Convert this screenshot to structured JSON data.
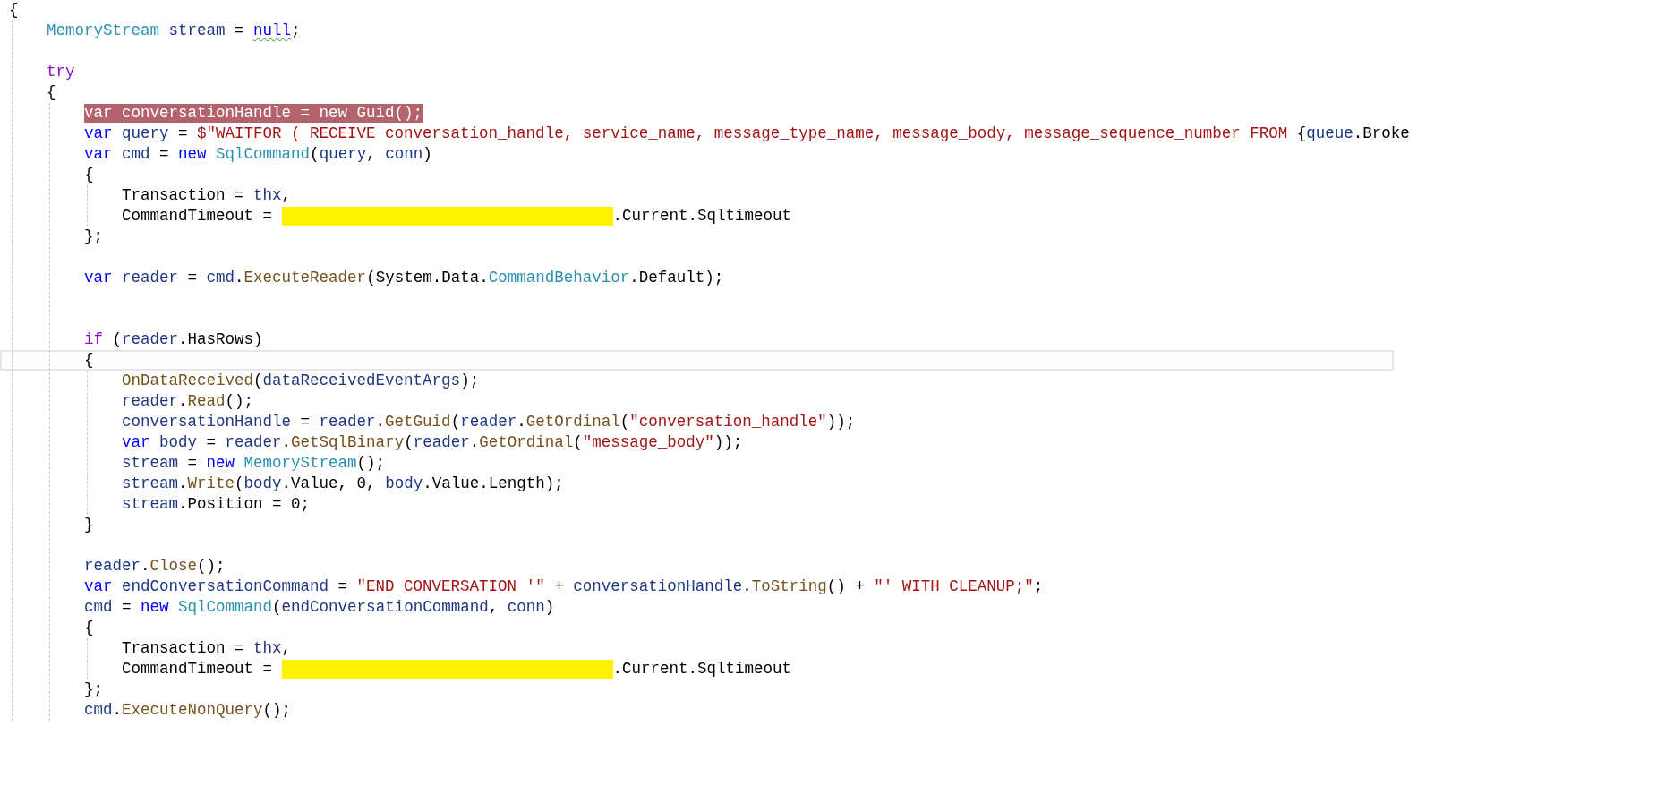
{
  "editor": {
    "lines": [
      {
        "kind": "code",
        "current": false,
        "segments": [
          {
            "kind": "code",
            "highlighted": false,
            "tokens": [
              {
                "text": "{",
                "kind": "plain"
              }
            ]
          }
        ]
      },
      {
        "kind": "code",
        "current": false,
        "segments": [
          {
            "kind": "code",
            "highlighted": false,
            "tokens": [
              {
                "text": "    MemoryStream",
                "kind": "type"
              },
              {
                "text": " stream",
                "kind": "ident"
              },
              {
                "text": " = ",
                "kind": "plain"
              },
              {
                "text": "null",
                "kind": "keyword",
                "warning": true
              },
              {
                "text": ";",
                "kind": "plain"
              }
            ]
          }
        ]
      },
      {
        "kind": "blank",
        "current": false
      },
      {
        "kind": "code",
        "current": false,
        "segments": [
          {
            "kind": "code",
            "highlighted": false,
            "tokens": [
              {
                "text": "    try",
                "kind": "control"
              }
            ]
          }
        ]
      },
      {
        "kind": "code",
        "current": false,
        "segments": [
          {
            "kind": "code",
            "highlighted": false,
            "tokens": [
              {
                "text": "    {",
                "kind": "plain"
              }
            ]
          }
        ]
      },
      {
        "kind": "code",
        "current": false,
        "segments": [
          {
            "kind": "code",
            "highlighted": true,
            "tokens": [
              {
                "text": "        var conversationHandle = new Guid();",
                "kind": "plain"
              }
            ]
          }
        ]
      },
      {
        "kind": "code",
        "current": false,
        "segments": [
          {
            "kind": "code",
            "highlighted": false,
            "tokens": [
              {
                "text": "        var",
                "kind": "keyword"
              },
              {
                "text": " query",
                "kind": "ident"
              },
              {
                "text": " = ",
                "kind": "plain"
              },
              {
                "text": "$\"WAITFOR ( RECEIVE conversation_handle, service_name, message_type_name, message_body, message_sequence_number FROM ",
                "kind": "string"
              },
              {
                "text": "{",
                "kind": "plain"
              },
              {
                "text": "queue",
                "kind": "ident"
              },
              {
                "text": ".Broke",
                "kind": "plain"
              }
            ]
          }
        ]
      },
      {
        "kind": "code",
        "current": false,
        "segments": [
          {
            "kind": "code",
            "highlighted": false,
            "tokens": [
              {
                "text": "        var",
                "kind": "keyword"
              },
              {
                "text": " cmd",
                "kind": "ident"
              },
              {
                "text": " = ",
                "kind": "plain"
              },
              {
                "text": "new",
                "kind": "keyword"
              },
              {
                "text": " SqlCommand",
                "kind": "type"
              },
              {
                "text": "(",
                "kind": "plain"
              },
              {
                "text": "query",
                "kind": "ident"
              },
              {
                "text": ", ",
                "kind": "plain"
              },
              {
                "text": "conn",
                "kind": "ident"
              },
              {
                "text": ")",
                "kind": "plain"
              }
            ]
          }
        ]
      },
      {
        "kind": "code",
        "current": false,
        "segments": [
          {
            "kind": "code",
            "highlighted": false,
            "tokens": [
              {
                "text": "        {",
                "kind": "plain"
              }
            ]
          }
        ]
      },
      {
        "kind": "code",
        "current": false,
        "segments": [
          {
            "kind": "code",
            "highlighted": false,
            "tokens": [
              {
                "text": "            Transaction = ",
                "kind": "plain"
              },
              {
                "text": "thx",
                "kind": "ident"
              },
              {
                "text": ",",
                "kind": "plain"
              }
            ]
          }
        ]
      },
      {
        "kind": "code",
        "current": false,
        "segments": [
          {
            "kind": "code",
            "highlighted": false,
            "tokens": [
              {
                "text": "            CommandTimeout =",
                "kind": "plain"
              }
            ]
          },
          {
            "kind": "redaction"
          },
          {
            "kind": "code",
            "highlighted": false,
            "tokens": [
              {
                "text": ".Current.Sqltimeout",
                "kind": "plain"
              }
            ]
          }
        ]
      },
      {
        "kind": "code",
        "current": false,
        "segments": [
          {
            "kind": "code",
            "highlighted": false,
            "tokens": [
              {
                "text": "        };",
                "kind": "plain"
              }
            ]
          }
        ]
      },
      {
        "kind": "blank",
        "current": false
      },
      {
        "kind": "code",
        "current": false,
        "segments": [
          {
            "kind": "code",
            "highlighted": false,
            "tokens": [
              {
                "text": "        var",
                "kind": "keyword"
              },
              {
                "text": " reader",
                "kind": "ident"
              },
              {
                "text": " = ",
                "kind": "plain"
              },
              {
                "text": "cmd",
                "kind": "ident"
              },
              {
                "text": ".",
                "kind": "plain"
              },
              {
                "text": "ExecuteReader",
                "kind": "method"
              },
              {
                "text": "(System.Data.",
                "kind": "plain"
              },
              {
                "text": "CommandBehavior",
                "kind": "type"
              },
              {
                "text": ".Default);",
                "kind": "plain"
              }
            ]
          }
        ]
      },
      {
        "kind": "blank",
        "current": false
      },
      {
        "kind": "blank",
        "current": false
      },
      {
        "kind": "code",
        "current": false,
        "segments": [
          {
            "kind": "code",
            "highlighted": false,
            "tokens": [
              {
                "text": "        if",
                "kind": "control"
              },
              {
                "text": " (",
                "kind": "plain"
              },
              {
                "text": "reader",
                "kind": "ident"
              },
              {
                "text": ".HasRows)",
                "kind": "plain"
              }
            ]
          }
        ]
      },
      {
        "kind": "code",
        "current": true,
        "segments": [
          {
            "kind": "code",
            "highlighted": false,
            "tokens": [
              {
                "text": "        {",
                "kind": "plain"
              }
            ]
          }
        ]
      },
      {
        "kind": "code",
        "current": false,
        "segments": [
          {
            "kind": "code",
            "highlighted": false,
            "tokens": [
              {
                "text": "            OnDataReceived",
                "kind": "method"
              },
              {
                "text": "(",
                "kind": "plain"
              },
              {
                "text": "dataReceivedEventArgs",
                "kind": "ident"
              },
              {
                "text": ");",
                "kind": "plain"
              }
            ]
          }
        ]
      },
      {
        "kind": "code",
        "current": false,
        "segments": [
          {
            "kind": "code",
            "highlighted": false,
            "tokens": [
              {
                "text": "            reader",
                "kind": "ident"
              },
              {
                "text": ".",
                "kind": "plain"
              },
              {
                "text": "Read",
                "kind": "method"
              },
              {
                "text": "();",
                "kind": "plain"
              }
            ]
          }
        ]
      },
      {
        "kind": "code",
        "current": false,
        "segments": [
          {
            "kind": "code",
            "highlighted": false,
            "tokens": [
              {
                "text": "            conversationHandle",
                "kind": "ident"
              },
              {
                "text": " = ",
                "kind": "plain"
              },
              {
                "text": "reader",
                "kind": "ident"
              },
              {
                "text": ".",
                "kind": "plain"
              },
              {
                "text": "GetGuid",
                "kind": "method"
              },
              {
                "text": "(",
                "kind": "plain"
              },
              {
                "text": "reader",
                "kind": "ident"
              },
              {
                "text": ".",
                "kind": "plain"
              },
              {
                "text": "GetOrdinal",
                "kind": "method"
              },
              {
                "text": "(",
                "kind": "plain"
              },
              {
                "text": "\"conversation_handle\"",
                "kind": "string"
              },
              {
                "text": "));",
                "kind": "plain"
              }
            ]
          }
        ]
      },
      {
        "kind": "code",
        "current": false,
        "segments": [
          {
            "kind": "code",
            "highlighted": false,
            "tokens": [
              {
                "text": "            var",
                "kind": "keyword"
              },
              {
                "text": " body",
                "kind": "ident"
              },
              {
                "text": " = ",
                "kind": "plain"
              },
              {
                "text": "reader",
                "kind": "ident"
              },
              {
                "text": ".",
                "kind": "plain"
              },
              {
                "text": "GetSqlBinary",
                "kind": "method"
              },
              {
                "text": "(",
                "kind": "plain"
              },
              {
                "text": "reader",
                "kind": "ident"
              },
              {
                "text": ".",
                "kind": "plain"
              },
              {
                "text": "GetOrdinal",
                "kind": "method"
              },
              {
                "text": "(",
                "kind": "plain"
              },
              {
                "text": "\"message_body\"",
                "kind": "string"
              },
              {
                "text": "));",
                "kind": "plain"
              }
            ]
          }
        ]
      },
      {
        "kind": "code",
        "current": false,
        "segments": [
          {
            "kind": "code",
            "highlighted": false,
            "tokens": [
              {
                "text": "            stream",
                "kind": "ident"
              },
              {
                "text": " = ",
                "kind": "plain"
              },
              {
                "text": "new",
                "kind": "keyword"
              },
              {
                "text": " MemoryStream",
                "kind": "type"
              },
              {
                "text": "();",
                "kind": "plain"
              }
            ]
          }
        ]
      },
      {
        "kind": "code",
        "current": false,
        "segments": [
          {
            "kind": "code",
            "highlighted": false,
            "tokens": [
              {
                "text": "            stream",
                "kind": "ident"
              },
              {
                "text": ".",
                "kind": "plain"
              },
              {
                "text": "Write",
                "kind": "method"
              },
              {
                "text": "(",
                "kind": "plain"
              },
              {
                "text": "body",
                "kind": "ident"
              },
              {
                "text": ".Value, 0, ",
                "kind": "plain"
              },
              {
                "text": "body",
                "kind": "ident"
              },
              {
                "text": ".Value.Length);",
                "kind": "plain"
              }
            ]
          }
        ]
      },
      {
        "kind": "code",
        "current": false,
        "segments": [
          {
            "kind": "code",
            "highlighted": false,
            "tokens": [
              {
                "text": "            stream",
                "kind": "ident"
              },
              {
                "text": ".Position = 0;",
                "kind": "plain"
              }
            ]
          }
        ]
      },
      {
        "kind": "code",
        "current": false,
        "segments": [
          {
            "kind": "code",
            "highlighted": false,
            "tokens": [
              {
                "text": "        }",
                "kind": "plain"
              }
            ]
          }
        ]
      },
      {
        "kind": "blank",
        "current": false
      },
      {
        "kind": "code",
        "current": false,
        "segments": [
          {
            "kind": "code",
            "highlighted": false,
            "tokens": [
              {
                "text": "        reader",
                "kind": "ident"
              },
              {
                "text": ".",
                "kind": "plain"
              },
              {
                "text": "Close",
                "kind": "method"
              },
              {
                "text": "();",
                "kind": "plain"
              }
            ]
          }
        ]
      },
      {
        "kind": "code",
        "current": false,
        "segments": [
          {
            "kind": "code",
            "highlighted": false,
            "tokens": [
              {
                "text": "        var",
                "kind": "keyword"
              },
              {
                "text": " endConversationCommand",
                "kind": "ident"
              },
              {
                "text": " = ",
                "kind": "plain"
              },
              {
                "text": "\"END CONVERSATION '\"",
                "kind": "string"
              },
              {
                "text": " + ",
                "kind": "plain"
              },
              {
                "text": "conversationHandle",
                "kind": "ident"
              },
              {
                "text": ".",
                "kind": "plain"
              },
              {
                "text": "ToString",
                "kind": "method"
              },
              {
                "text": "() + ",
                "kind": "plain"
              },
              {
                "text": "\"' WITH CLEANUP;\"",
                "kind": "string"
              },
              {
                "text": ";",
                "kind": "plain"
              }
            ]
          }
        ]
      },
      {
        "kind": "code",
        "current": false,
        "segments": [
          {
            "kind": "code",
            "highlighted": false,
            "tokens": [
              {
                "text": "        cmd",
                "kind": "ident"
              },
              {
                "text": " = ",
                "kind": "plain"
              },
              {
                "text": "new",
                "kind": "keyword"
              },
              {
                "text": " SqlCommand",
                "kind": "type"
              },
              {
                "text": "(",
                "kind": "plain"
              },
              {
                "text": "endConversationCommand",
                "kind": "ident"
              },
              {
                "text": ", ",
                "kind": "plain"
              },
              {
                "text": "conn",
                "kind": "ident"
              },
              {
                "text": ")",
                "kind": "plain"
              }
            ]
          }
        ]
      },
      {
        "kind": "code",
        "current": false,
        "segments": [
          {
            "kind": "code",
            "highlighted": false,
            "tokens": [
              {
                "text": "        {",
                "kind": "plain"
              }
            ]
          }
        ]
      },
      {
        "kind": "code",
        "current": false,
        "segments": [
          {
            "kind": "code",
            "highlighted": false,
            "tokens": [
              {
                "text": "            Transaction = ",
                "kind": "plain"
              },
              {
                "text": "thx",
                "kind": "ident"
              },
              {
                "text": ",",
                "kind": "plain"
              }
            ]
          }
        ]
      },
      {
        "kind": "code",
        "current": false,
        "segments": [
          {
            "kind": "code",
            "highlighted": false,
            "tokens": [
              {
                "text": "            CommandTimeout =",
                "kind": "plain"
              }
            ]
          },
          {
            "kind": "redaction"
          },
          {
            "kind": "code",
            "highlighted": false,
            "tokens": [
              {
                "text": ".Current.Sqltimeout",
                "kind": "plain"
              }
            ]
          }
        ]
      },
      {
        "kind": "code",
        "current": false,
        "segments": [
          {
            "kind": "code",
            "highlighted": false,
            "tokens": [
              {
                "text": "        };",
                "kind": "plain"
              }
            ]
          }
        ]
      },
      {
        "kind": "code",
        "current": false,
        "segments": [
          {
            "kind": "code",
            "highlighted": false,
            "tokens": [
              {
                "text": "        cmd",
                "kind": "ident"
              },
              {
                "text": ".",
                "kind": "plain"
              },
              {
                "text": "ExecuteNonQuery",
                "kind": "method"
              },
              {
                "text": "();",
                "kind": "plain"
              }
            ]
          }
        ]
      }
    ]
  }
}
